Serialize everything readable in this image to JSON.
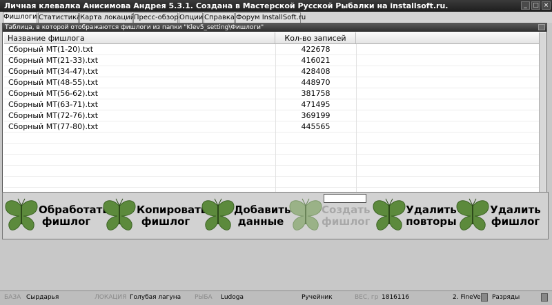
{
  "window": {
    "title": "Личная клевалка Анисимова Андрея 5.3.1. Создана в Мастерской Русской Рыбалки на installsoft.ru."
  },
  "tabs": [
    {
      "label": "Фишлоги",
      "active": true
    },
    {
      "label": "Статистика"
    },
    {
      "label": "Карта локаций"
    },
    {
      "label": "Пресс-обзор"
    },
    {
      "label": "Опции"
    },
    {
      "label": "Справка"
    },
    {
      "label": "Форум InstallSoft.ru"
    }
  ],
  "panel": {
    "title": "Таблица, в которой отображаются фишлоги из папки \"Klev5_setting\\Фишлоги\""
  },
  "table": {
    "columns": [
      "Название фишлога",
      "Кол-во записей"
    ],
    "rows": [
      {
        "name": "Сборный МТ(1-20).txt",
        "count": "422678"
      },
      {
        "name": "Сборный МТ(21-33).txt",
        "count": "416021"
      },
      {
        "name": "Сборный МТ(34-47).txt",
        "count": "428408"
      },
      {
        "name": "Сборный МТ(48-55).txt",
        "count": "448970"
      },
      {
        "name": "Сборный МТ(56-62).txt",
        "count": "381758"
      },
      {
        "name": "Сборный МТ(63-71).txt",
        "count": "471495"
      },
      {
        "name": "Сборный МТ(72-76).txt",
        "count": "369199"
      },
      {
        "name": "Сборный МТ(77-80).txt",
        "count": "445565"
      }
    ]
  },
  "actions": [
    {
      "line1": "Обработать",
      "line2": "фишлог",
      "enabled": true
    },
    {
      "line1": "Копировать",
      "line2": "фишлог",
      "enabled": true
    },
    {
      "line1": "Добавить",
      "line2": "данные",
      "enabled": true
    },
    {
      "line1": "Создать",
      "line2": "фишлог",
      "enabled": false
    },
    {
      "line1": "Удалить",
      "line2": "повторы",
      "enabled": true
    },
    {
      "line1": "Удалить",
      "line2": "фишлог",
      "enabled": true
    }
  ],
  "colors": {
    "butterfly": "#5c8a3c",
    "butterfly_dark": "#3d6426",
    "butterfly_disabled": "#9ab287"
  },
  "status": {
    "base_label": "БАЗА",
    "base_value": "Сырдарья",
    "location_label": "ЛОКАЦИЯ",
    "location_value": "Голубая лагуна",
    "fish_label": "РЫБА",
    "fish_value": "Ludoga",
    "bait_value": "Ручейник",
    "weight_label": "ВЕС, гр",
    "weight_value": "1816116",
    "mode_value": "2. FineVe",
    "digits_value": "Разряды"
  }
}
